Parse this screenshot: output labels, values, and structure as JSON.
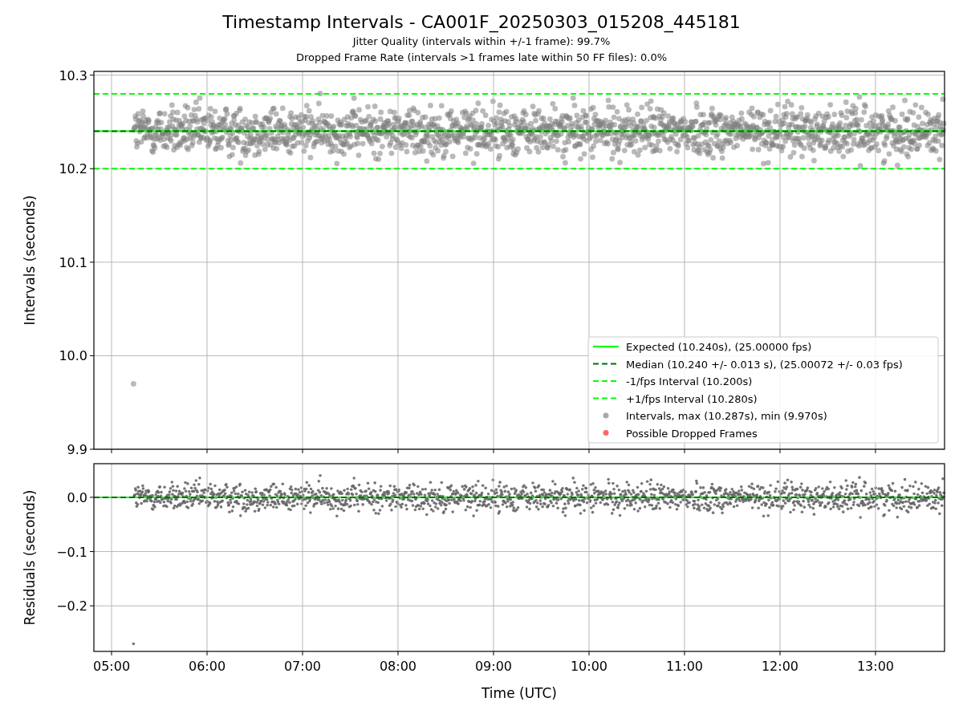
{
  "figure": {
    "title": "Timestamp Intervals - CA001F_20250303_015208_445181",
    "subtitles": [
      "Jitter Quality (intervals within +/-1 frame): 99.7%",
      "Dropped Frame Rate (intervals >1 frames late within 50 FF files): 0.0%"
    ]
  },
  "intervals_plot": {
    "chart_data": {
      "type": "line",
      "grid": true,
      "legend": "lower right",
      "ylabel": "Intervals (seconds)",
      "x": [
        4.815,
        13.723
      ],
      "xlim": [
        4.815,
        13.723
      ],
      "ylim": [
        9.9,
        10.304
      ],
      "yticks": [
        {
          "value": 10.3,
          "label": "10.3"
        },
        {
          "value": 10.2,
          "label": "10.2"
        },
        {
          "value": 10.1,
          "label": "10.1"
        },
        {
          "value": 10.0,
          "label": "10.0"
        },
        {
          "value": 9.9,
          "label": "9.9"
        }
      ],
      "series": [
        {
          "name": "Expected (10.240s), (25.00000 fps)",
          "color": "#00ff00",
          "line_style": "solid",
          "values": [
            10.24,
            10.24
          ]
        },
        {
          "name": "Median (10.240 +/- 0.013 s), (25.00072 +/- 0.03 fps)",
          "color": "#007000",
          "line_style": "dashed",
          "values": [
            10.24,
            10.24
          ]
        },
        {
          "name": "-1/fps Interval (10.200s)",
          "color": "#00ff00",
          "line_style": "dashed",
          "values": [
            10.2,
            10.2
          ]
        },
        {
          "name": "+1/fps Interval (10.280s)",
          "color": "#00ff00",
          "line_style": "dashed",
          "values": [
            10.28,
            10.28
          ]
        }
      ]
    },
    "legend_markers": [
      {
        "label": "Intervals, max (10.287s), min (9.970s)",
        "color": "#a8a8a8"
      },
      {
        "label": "Possible Dropped Frames",
        "color": "#ff6666"
      }
    ]
  },
  "residuals_plot": {
    "chart_data": {
      "type": "line",
      "grid": true,
      "xlabel": "Time (UTC)",
      "ylabel": "Residuals (seconds)",
      "x": [
        4.815,
        13.723
      ],
      "xlim": [
        4.815,
        13.723
      ],
      "ylim": [
        -0.284,
        0.062
      ],
      "xticks": [
        {
          "value": 5,
          "label": "05:00"
        },
        {
          "value": 6,
          "label": "06:00"
        },
        {
          "value": 7,
          "label": "07:00"
        },
        {
          "value": 8,
          "label": "08:00"
        },
        {
          "value": 9,
          "label": "09:00"
        },
        {
          "value": 10,
          "label": "10:00"
        },
        {
          "value": 11,
          "label": "11:00"
        },
        {
          "value": 12,
          "label": "12:00"
        },
        {
          "value": 13,
          "label": "13:00"
        }
      ],
      "yticks": [
        {
          "value": 0,
          "label": "0.0"
        },
        {
          "value": -0.1,
          "label": "−0.1"
        },
        {
          "value": -0.2,
          "label": "−0.2"
        }
      ],
      "series": [
        {
          "color": "#00ff00",
          "line_style": "solid",
          "values": [
            0,
            0
          ]
        },
        {
          "color": "#007000",
          "line_style": "dashed",
          "values": [
            0,
            0
          ]
        }
      ]
    }
  }
}
